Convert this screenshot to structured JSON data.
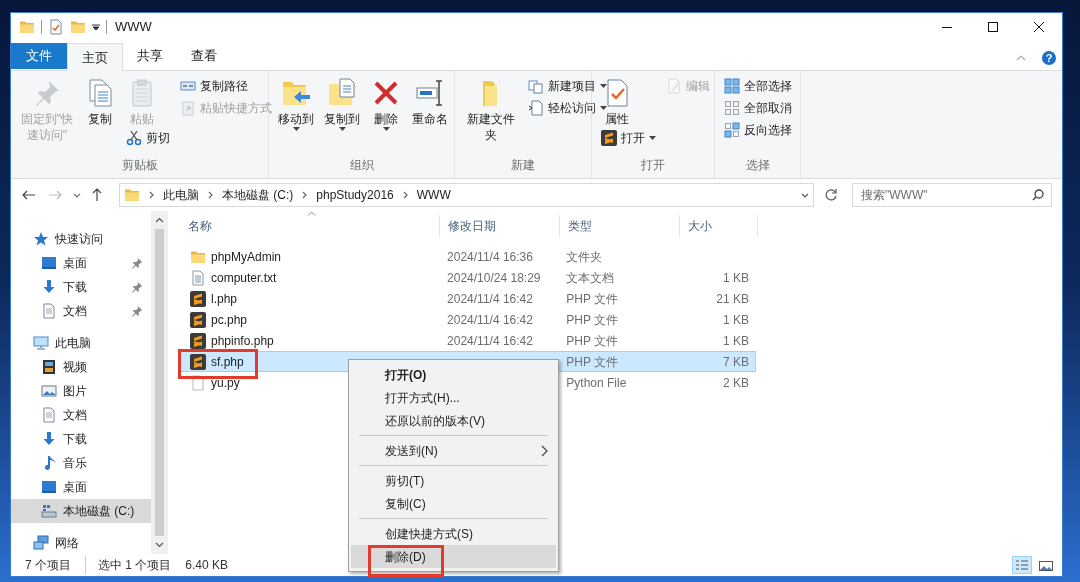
{
  "window": {
    "title": "WWW"
  },
  "tabs": [
    {
      "label": "文件",
      "kind": "file",
      "selected": false
    },
    {
      "label": "主页",
      "kind": "tab",
      "selected": true
    },
    {
      "label": "共享",
      "kind": "tab",
      "selected": false
    },
    {
      "label": "查看",
      "kind": "tab",
      "selected": false
    }
  ],
  "ribbon": {
    "help_button": "?",
    "groups": [
      {
        "name": "剪贴板",
        "items": [
          {
            "label": "固定到\"快速访问\"",
            "kind": "large",
            "disabled": true,
            "dropdown": false
          },
          {
            "label": "复制",
            "kind": "large",
            "disabled": false,
            "dropdown": false
          },
          {
            "label": "粘贴",
            "kind": "large",
            "disabled": true,
            "dropdown": false
          },
          {
            "label": "剪切",
            "kind": "small",
            "disabled": false,
            "dropdown": false
          },
          {
            "label": "复制路径",
            "kind": "small",
            "disabled": false,
            "dropdown": false
          },
          {
            "label": "粘贴快捷方式",
            "kind": "small",
            "disabled": true,
            "dropdown": false
          }
        ]
      },
      {
        "name": "组织",
        "items": [
          {
            "label": "移动到",
            "kind": "large",
            "disabled": false,
            "dropdown": true
          },
          {
            "label": "复制到",
            "kind": "large",
            "disabled": false,
            "dropdown": true
          },
          {
            "label": "删除",
            "kind": "large",
            "disabled": false,
            "dropdown": true
          },
          {
            "label": "重命名",
            "kind": "large",
            "disabled": false,
            "dropdown": false
          }
        ]
      },
      {
        "name": "新建",
        "items": [
          {
            "label": "新建文件夹",
            "kind": "large",
            "disabled": false,
            "dropdown": false
          },
          {
            "label": "新建项目",
            "kind": "small",
            "disabled": false,
            "dropdown": true
          },
          {
            "label": "轻松访问",
            "kind": "small",
            "disabled": false,
            "dropdown": true
          }
        ]
      },
      {
        "name": "打开",
        "items": [
          {
            "label": "属性",
            "kind": "large",
            "disabled": false,
            "dropdown": false
          },
          {
            "label": "打开",
            "kind": "small",
            "disabled": false,
            "dropdown": true
          },
          {
            "label": "编辑",
            "kind": "small",
            "disabled": true,
            "dropdown": false
          }
        ]
      },
      {
        "name": "选择",
        "items": [
          {
            "label": "全部选择",
            "kind": "small",
            "disabled": false,
            "dropdown": false
          },
          {
            "label": "全部取消",
            "kind": "small",
            "disabled": false,
            "dropdown": false
          },
          {
            "label": "反向选择",
            "kind": "small",
            "disabled": false,
            "dropdown": false
          }
        ]
      }
    ]
  },
  "address": {
    "crumbs": [
      "此电脑",
      "本地磁盘 (C:)",
      "phpStudy2016",
      "WWW"
    ]
  },
  "search": {
    "placeholder": "搜索\"WWW\""
  },
  "nav": [
    {
      "label": "快速访问",
      "selected": false,
      "pinned": false,
      "children": [
        {
          "label": "桌面",
          "selected": false,
          "pinned": true
        },
        {
          "label": "下载",
          "selected": false,
          "pinned": true
        },
        {
          "label": "文档",
          "selected": false,
          "pinned": true
        }
      ]
    },
    {
      "label": "此电脑",
      "selected": false,
      "pinned": false,
      "children": [
        {
          "label": "视频",
          "selected": false,
          "pinned": false
        },
        {
          "label": "图片",
          "selected": false,
          "pinned": false
        },
        {
          "label": "文档",
          "selected": false,
          "pinned": false
        },
        {
          "label": "下载",
          "selected": false,
          "pinned": false
        },
        {
          "label": "音乐",
          "selected": false,
          "pinned": false
        },
        {
          "label": "桌面",
          "selected": false,
          "pinned": false
        },
        {
          "label": "本地磁盘 (C:)",
          "selected": true,
          "pinned": false
        }
      ]
    },
    {
      "label": "网络",
      "selected": false,
      "pinned": false
    }
  ],
  "columns": [
    "名称",
    "修改日期",
    "类型",
    "大小"
  ],
  "files": [
    {
      "name": "phpMyAdmin",
      "kind": "folder",
      "date": "2024/11/4 16:36",
      "type": "文件夹",
      "selected": false,
      "highlighted": false
    },
    {
      "name": "computer.txt",
      "kind": "text",
      "date": "2024/10/24 18:29",
      "type": "文本文档",
      "size": "1 KB",
      "selected": false,
      "highlighted": false
    },
    {
      "name": "l.php",
      "kind": "php",
      "date": "2024/11/4 16:42",
      "type": "PHP 文件",
      "size": "21 KB",
      "selected": false,
      "highlighted": false
    },
    {
      "name": "pc.php",
      "kind": "php",
      "date": "2024/11/4 16:42",
      "type": "PHP 文件",
      "size": "1 KB",
      "selected": false,
      "highlighted": false
    },
    {
      "name": "phpinfo.php",
      "kind": "php",
      "date": "2024/11/4 16:42",
      "type": "PHP 文件",
      "size": "1 KB",
      "selected": false,
      "highlighted": false
    },
    {
      "name": "sf.php",
      "kind": "php",
      "type": "PHP 文件",
      "size": "7 KB",
      "selected": true,
      "highlighted": true
    },
    {
      "name": "yu.py",
      "kind": "python",
      "type": "Python File",
      "size": "2 KB",
      "selected": false,
      "highlighted": false
    }
  ],
  "context_menu": [
    {
      "kind": "item",
      "label": "打开(O)",
      "default": true,
      "submenu": false,
      "hovered": false,
      "highlighted": false
    },
    {
      "kind": "item",
      "label": "打开方式(H)...",
      "default": false,
      "submenu": false,
      "hovered": false,
      "highlighted": false
    },
    {
      "kind": "item",
      "label": "还原以前的版本(V)",
      "default": false,
      "submenu": false,
      "hovered": false,
      "highlighted": false
    },
    {
      "kind": "separator"
    },
    {
      "kind": "item",
      "label": "发送到(N)",
      "default": false,
      "submenu": true,
      "hovered": false,
      "highlighted": false
    },
    {
      "kind": "separator"
    },
    {
      "kind": "item",
      "label": "剪切(T)",
      "default": false,
      "submenu": false,
      "hovered": false,
      "highlighted": false
    },
    {
      "kind": "item",
      "label": "复制(C)",
      "default": false,
      "submenu": false,
      "hovered": false,
      "highlighted": false
    },
    {
      "kind": "separator"
    },
    {
      "kind": "item",
      "label": "创建快捷方式(S)",
      "default": false,
      "submenu": false,
      "hovered": false,
      "highlighted": false
    },
    {
      "kind": "item",
      "label": "删除(D)",
      "default": false,
      "submenu": false,
      "hovered": true,
      "highlighted": true
    }
  ],
  "status_bar": {
    "items": [
      "7 个项目",
      "选中 1 个项目",
      "6.40 KB"
    ],
    "views": [
      {
        "selected": true
      },
      {
        "selected": false
      }
    ]
  }
}
